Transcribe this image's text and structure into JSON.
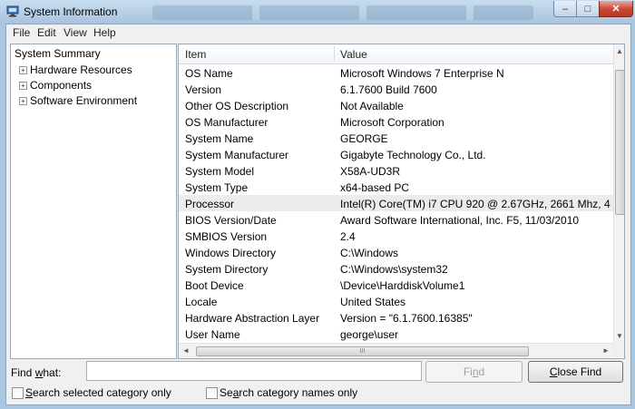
{
  "window": {
    "title": "System Information",
    "close_glyph": "✕",
    "maximize_glyph": "□",
    "minimize_glyph": "–"
  },
  "menu": [
    "File",
    "Edit",
    "View",
    "Help"
  ],
  "tree": {
    "root": "System Summary",
    "children": [
      {
        "label": "Hardware Resources",
        "expander": "+"
      },
      {
        "label": "Components",
        "expander": "+"
      },
      {
        "label": "Software Environment",
        "expander": "+"
      }
    ]
  },
  "table": {
    "columns": [
      "Item",
      "Value"
    ],
    "rows": [
      {
        "item": "OS Name",
        "value": "Microsoft Windows 7 Enterprise N"
      },
      {
        "item": "Version",
        "value": "6.1.7600 Build 7600"
      },
      {
        "item": "Other OS Description",
        "value": "Not Available"
      },
      {
        "item": "OS Manufacturer",
        "value": "Microsoft Corporation"
      },
      {
        "item": "System Name",
        "value": "GEORGE"
      },
      {
        "item": "System Manufacturer",
        "value": "Gigabyte Technology Co., Ltd."
      },
      {
        "item": "System Model",
        "value": "X58A-UD3R"
      },
      {
        "item": "System Type",
        "value": "x64-based PC"
      },
      {
        "item": "Processor",
        "value": "Intel(R) Core(TM) i7 CPU        920  @ 2.67GHz, 2661 Mhz, 4"
      },
      {
        "item": "BIOS Version/Date",
        "value": "Award Software International, Inc. F5, 11/03/2010"
      },
      {
        "item": "SMBIOS Version",
        "value": "2.4"
      },
      {
        "item": "Windows Directory",
        "value": "C:\\Windows"
      },
      {
        "item": "System Directory",
        "value": "C:\\Windows\\system32"
      },
      {
        "item": "Boot Device",
        "value": "\\Device\\HarddiskVolume1"
      },
      {
        "item": "Locale",
        "value": "United States"
      },
      {
        "item": "Hardware Abstraction Layer",
        "value": "Version = \"6.1.7600.16385\""
      },
      {
        "item": "User Name",
        "value": "george\\user"
      }
    ],
    "selected_item": "Processor"
  },
  "find": {
    "label_prefix": "Find ",
    "label_underlined": "w",
    "label_suffix": "hat:",
    "value": "",
    "find_button_prefix": "Fi",
    "find_button_underlined": "n",
    "find_button_suffix": "d",
    "close_button_underlined": "C",
    "close_button_suffix": "lose Find"
  },
  "options": [
    {
      "underlined": "S",
      "label_rest": "earch selected category only",
      "checked": false
    },
    {
      "prefix": "Se",
      "underlined": "a",
      "label_rest": "rch category names only",
      "checked": false
    }
  ],
  "scroll_glyphs": {
    "up": "▲",
    "down": "▼",
    "left": "◄",
    "right": "►",
    "grip": "III"
  },
  "colors": {
    "accent": "#3a6ea5",
    "selection": "#ececec"
  }
}
